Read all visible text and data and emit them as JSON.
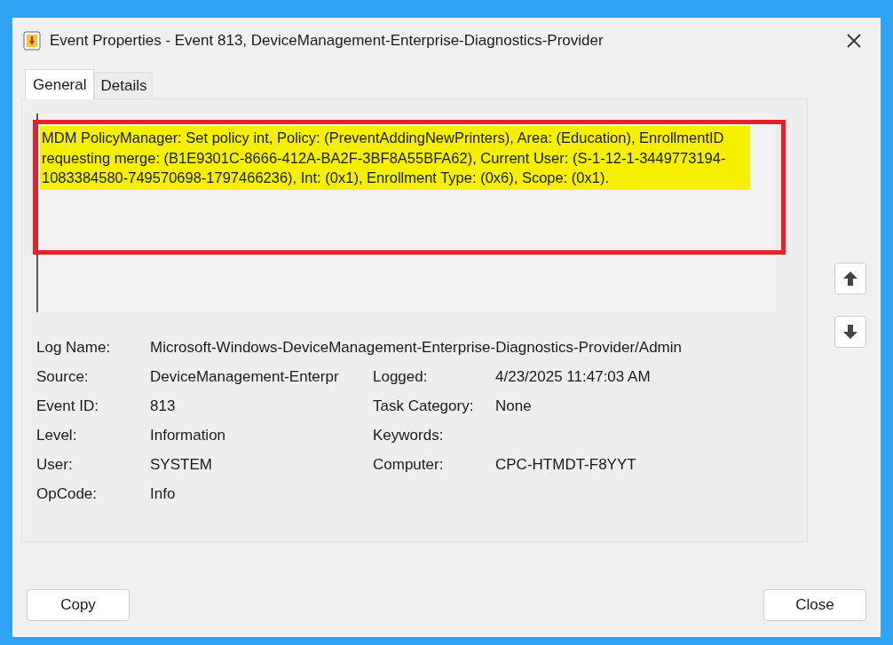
{
  "window": {
    "title": "Event Properties - Event 813, DeviceManagement-Enterprise-Diagnostics-Provider"
  },
  "tabs": [
    {
      "label": "General",
      "selected": true
    },
    {
      "label": "Details",
      "selected": false
    }
  ],
  "description": {
    "text": "MDM PolicyManager: Set policy int, Policy: (PreventAddingNewPrinters), Area: (Education), EnrollmentID requesting merge: (B1E9301C-8666-412A-BA2F-3BF8A55BFA62), Current User: (S-1-12-1-3449773194-1083384580-749570698-1797466236), Int: (0x1), Enrollment Type: (0x6), Scope: (0x1).",
    "highlighted": true
  },
  "log_name": {
    "label": "Log Name:",
    "value": "Microsoft-Windows-DeviceManagement-Enterprise-Diagnostics-Provider/Admin"
  },
  "rows": [
    {
      "left": {
        "label": "Source:",
        "value": "DeviceManagement-Enterpr"
      },
      "right": {
        "label": "Logged:",
        "value": "4/23/2025 11:47:03 AM"
      }
    },
    {
      "left": {
        "label": "Event ID:",
        "value": "813"
      },
      "right": {
        "label": "Task Category:",
        "value": "None"
      }
    },
    {
      "left": {
        "label": "Level:",
        "value": "Information"
      },
      "right": {
        "label": "Keywords:"
      }
    },
    {
      "left": {
        "label": "User:",
        "value": "SYSTEM"
      },
      "right": {
        "label": "Computer:",
        "value": "CPC-HTMDT-F8YYT"
      }
    },
    {
      "left": {
        "label": "OpCode:",
        "value": "Info"
      }
    }
  ],
  "buttons": {
    "copy": "Copy",
    "close": "Close"
  }
}
